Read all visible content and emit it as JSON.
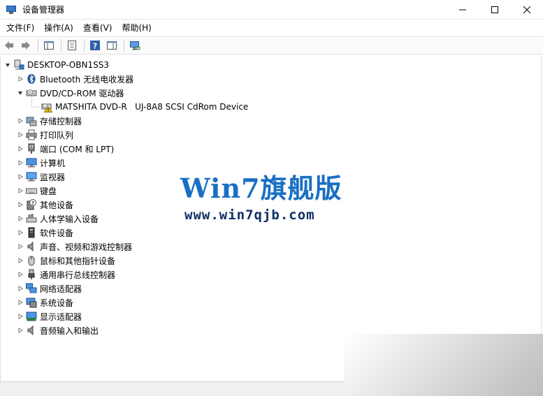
{
  "window": {
    "title": "设备管理器"
  },
  "menu": [
    {
      "label": "文件(F)"
    },
    {
      "label": "操作(A)"
    },
    {
      "label": "查看(V)"
    },
    {
      "label": "帮助(H)"
    }
  ],
  "tree": {
    "root": "DESKTOP-OBN1SS3",
    "items": [
      {
        "label": "Bluetooth 无线电收发器",
        "icon": "bluetooth-icon",
        "expanded": false
      },
      {
        "label": "DVD/CD-ROM 驱动器",
        "icon": "dvd-drive-icon",
        "expanded": true,
        "children": [
          {
            "label": "MATSHITA DVD-R   UJ-8A8 SCSI CdRom Device",
            "icon": "dvd-warning-icon"
          }
        ]
      },
      {
        "label": "存储控制器",
        "icon": "storage-icon",
        "expanded": false
      },
      {
        "label": "打印队列",
        "icon": "printer-icon",
        "expanded": false
      },
      {
        "label": "端口 (COM 和 LPT)",
        "icon": "port-icon",
        "expanded": false
      },
      {
        "label": "计算机",
        "icon": "computer-icon",
        "expanded": false
      },
      {
        "label": "监视器",
        "icon": "monitor-icon",
        "expanded": false
      },
      {
        "label": "键盘",
        "icon": "keyboard-icon",
        "expanded": false
      },
      {
        "label": "其他设备",
        "icon": "unknown-device-icon",
        "expanded": false
      },
      {
        "label": "人体学输入设备",
        "icon": "hid-icon",
        "expanded": false
      },
      {
        "label": "软件设备",
        "icon": "software-device-icon",
        "expanded": false
      },
      {
        "label": "声音、视频和游戏控制器",
        "icon": "speaker-icon",
        "expanded": false
      },
      {
        "label": "鼠标和其他指针设备",
        "icon": "mouse-icon",
        "expanded": false
      },
      {
        "label": "通用串行总线控制器",
        "icon": "usb-icon",
        "expanded": false
      },
      {
        "label": "网络适配器",
        "icon": "network-icon",
        "expanded": false
      },
      {
        "label": "系统设备",
        "icon": "system-device-icon",
        "expanded": false
      },
      {
        "label": "显示适配器",
        "icon": "display-adapter-icon",
        "expanded": false
      },
      {
        "label": "音频输入和输出",
        "icon": "audio-io-icon",
        "expanded": false
      }
    ]
  },
  "watermark": {
    "line1": "Win7旗舰版",
    "line2": "www.win7qjb.com"
  },
  "colors": {
    "watermark_primary": "#1a6fc2",
    "watermark_secondary": "#0e2f66",
    "icon_blue": "#3a79c9"
  }
}
